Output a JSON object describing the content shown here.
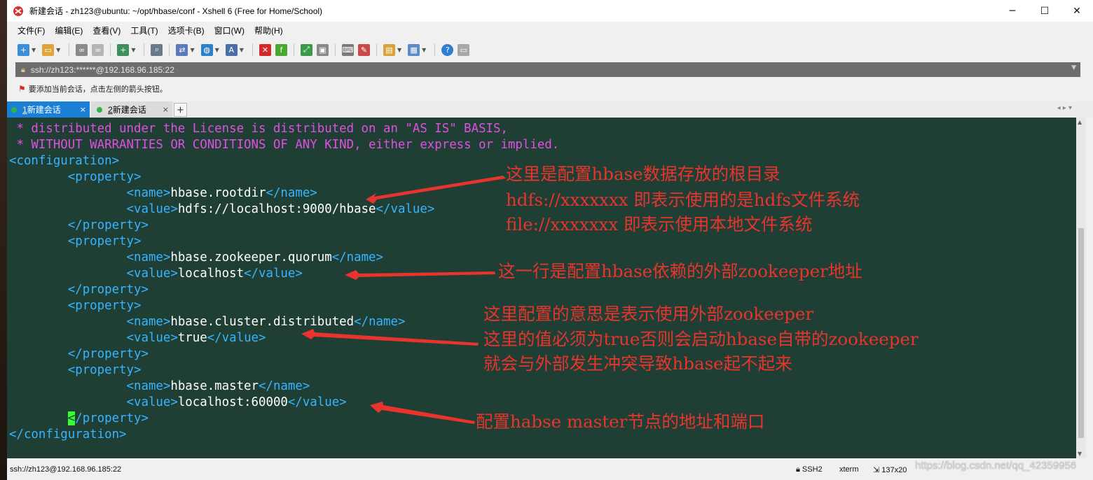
{
  "window": {
    "title": "新建会话 - zh123@ubuntu: ~/opt/hbase/conf - Xshell 6 (Free for Home/School)",
    "minimize": "─",
    "maximize": "☐",
    "close": "✕"
  },
  "menu": [
    "文件(F)",
    "编辑(E)",
    "查看(V)",
    "工具(T)",
    "选项卡(B)",
    "窗口(W)",
    "帮助(H)"
  ],
  "toolbar_icons": [
    "new-session-icon",
    "open-folder-icon",
    "connect-icon",
    "disconnect-icon",
    "new-tab-icon",
    "find-icon",
    "transfer-icon",
    "globe-icon",
    "font-icon",
    "xshell-icon",
    "xftp-icon",
    "fullscreen-icon",
    "lock-icon",
    "keyboard-icon",
    "highlight-icon",
    "script-folder-icon",
    "layout-icon",
    "help-icon",
    "chat-icon"
  ],
  "address": {
    "url": "ssh://zh123:******@192.168.96.185:22"
  },
  "hint": "要添加当前会话，点击左侧的箭头按钮。",
  "tabs": [
    {
      "number": "1",
      "label": "新建会话",
      "close": "×"
    },
    {
      "number": "2",
      "label": "新建会话",
      "close": "×"
    }
  ],
  "tab_add": "+",
  "terminal": {
    "lines": [
      {
        "type": "comment",
        "text": " * distributed under the License is distributed on an \"AS IS\" BASIS,"
      },
      {
        "type": "comment",
        "text": " * WITHOUT WARRANTIES OR CONDITIONS OF ANY KIND, either express or implied."
      },
      {
        "type": "open",
        "indent": 0,
        "tag": "configuration"
      },
      {
        "type": "open",
        "indent": 1,
        "tag": "property"
      },
      {
        "type": "element",
        "indent": 2,
        "tag": "name",
        "value": "hbase.rootdir"
      },
      {
        "type": "element",
        "indent": 2,
        "tag": "value",
        "value": "hdfs://localhost:9000/hbase"
      },
      {
        "type": "close",
        "indent": 1,
        "tag": "property"
      },
      {
        "type": "open",
        "indent": 1,
        "tag": "property"
      },
      {
        "type": "element",
        "indent": 2,
        "tag": "name",
        "value": "hbase.zookeeper.quorum"
      },
      {
        "type": "element",
        "indent": 2,
        "tag": "value",
        "value": "localhost"
      },
      {
        "type": "close",
        "indent": 1,
        "tag": "property"
      },
      {
        "type": "open",
        "indent": 1,
        "tag": "property"
      },
      {
        "type": "element",
        "indent": 2,
        "tag": "name",
        "value": "hbase.cluster.distributed"
      },
      {
        "type": "element",
        "indent": 2,
        "tag": "value",
        "value": "true"
      },
      {
        "type": "close",
        "indent": 1,
        "tag": "property"
      },
      {
        "type": "open",
        "indent": 1,
        "tag": "property"
      },
      {
        "type": "element",
        "indent": 2,
        "tag": "name",
        "value": "hbase.master"
      },
      {
        "type": "element",
        "indent": 2,
        "tag": "value",
        "value": "localhost:60000"
      },
      {
        "type": "close",
        "indent": 1,
        "tag": "property",
        "cursor": true
      },
      {
        "type": "close",
        "indent": 0,
        "tag": "configuration"
      }
    ]
  },
  "annotations": {
    "rootdir_1": "这里是配置hbase数据存放的根目录",
    "rootdir_2": "hdfs://xxxxxxx  即表示使用的是hdfs文件系统",
    "rootdir_3": "file://xxxxxxx   即表示使用本地文件系统",
    "quorum_1": "这一行是配置hbase依赖的外部zookeeper地址",
    "distributed_1": "这里配置的意思是表示使用外部zookeeper",
    "distributed_2": "这里的值必须为true否则会启动hbase自带的zookeeper",
    "distributed_3": "就会与外部发生冲突导致hbase起不起来",
    "master_1": "配置habse master节点的地址和端口"
  },
  "status": {
    "connection": "ssh://zh123@192.168.96.185:22",
    "protocol": "SSH2",
    "term": "xterm",
    "size": "137x20",
    "watermark": "https://blog.csdn.net/qq_42359956"
  },
  "colors": {
    "terminal_bg": "#1f3f35",
    "comment": "#e050e0",
    "tag": "#36b4ff",
    "text": "#ffffff",
    "annotation": "#e8342c",
    "tab_active": "#1c7fd6"
  }
}
